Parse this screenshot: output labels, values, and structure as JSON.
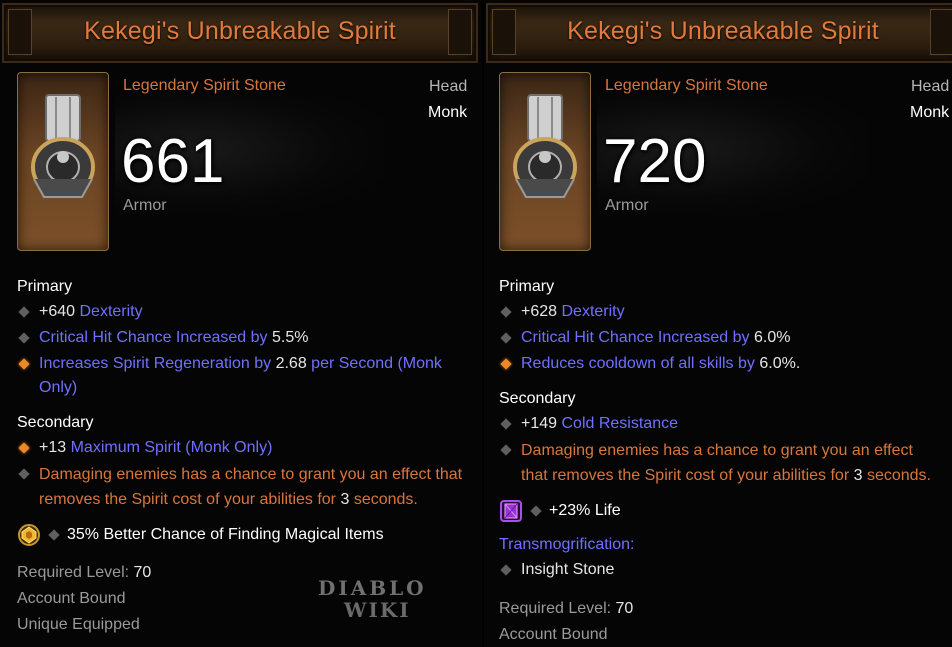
{
  "left": {
    "title": "Kekegi's Unbreakable Spirit",
    "type": "Legendary Spirit Stone",
    "slot": "Head",
    "class": "Monk",
    "armor": "661",
    "armor_label": "Armor",
    "primary_label": "Primary",
    "primary": [
      {
        "a": "+640",
        "b": "Dexterity"
      },
      {
        "a": "Critical Hit Chance Increased by",
        "b": "5.5%"
      },
      {
        "a": "Increases Spirit Regeneration by",
        "b": "2.68",
        "c": "per Second (Monk Only)"
      }
    ],
    "secondary_label": "Secondary",
    "secondary": [
      {
        "a": "+13",
        "b": "Maximum Spirit (Monk Only)"
      },
      {
        "a": "Damaging enemies has a chance to grant you an effect that removes the Spirit cost of your abilities for",
        "b": "3",
        "c": "seconds."
      }
    ],
    "gem_effect": "35% Better Chance of Finding Magical Items",
    "required_level_label": "Required Level:",
    "required_level": "70",
    "account_bound": "Account Bound",
    "unique_equipped": "Unique Equipped",
    "watermark_top": "DIABLO",
    "watermark_bottom": "WIKI"
  },
  "right": {
    "title": "Kekegi's Unbreakable Spirit",
    "type": "Legendary Spirit Stone",
    "slot": "Head",
    "class": "Monk",
    "armor": "720",
    "armor_label": "Armor",
    "primary_label": "Primary",
    "primary": [
      {
        "a": "+628",
        "b": "Dexterity"
      },
      {
        "a": "Critical Hit Chance Increased by",
        "b": "6.0%"
      },
      {
        "a": "Reduces cooldown of all skills by",
        "b": "6.0%",
        "c": "."
      }
    ],
    "secondary_label": "Secondary",
    "secondary": [
      {
        "a": "+149",
        "b": "Cold Resistance"
      },
      {
        "a": "Damaging enemies has a chance to grant you an effect that removes the Spirit cost of your abilities for",
        "b": "3",
        "c": "seconds."
      }
    ],
    "gem_effect": "+23% Life",
    "transmog_label": "Transmogrification:",
    "transmog_value": "Insight Stone",
    "required_level_label": "Required Level:",
    "required_level": "70",
    "account_bound": "Account Bound"
  },
  "colors": {
    "legendary_orange": "#d9763c",
    "magic_blue": "#7070ff",
    "white": "#ffffff",
    "grey": "#9a9a9a",
    "bullet_gold": "#e88a25",
    "bullet_grey": "#5f5f5f"
  },
  "icons": {
    "item": "spirit-stone-helm-icon",
    "bullet": "diamond-bullet-icon",
    "gem_left": "topaz-gem-icon",
    "gem_right": "amethyst-gem-icon"
  }
}
